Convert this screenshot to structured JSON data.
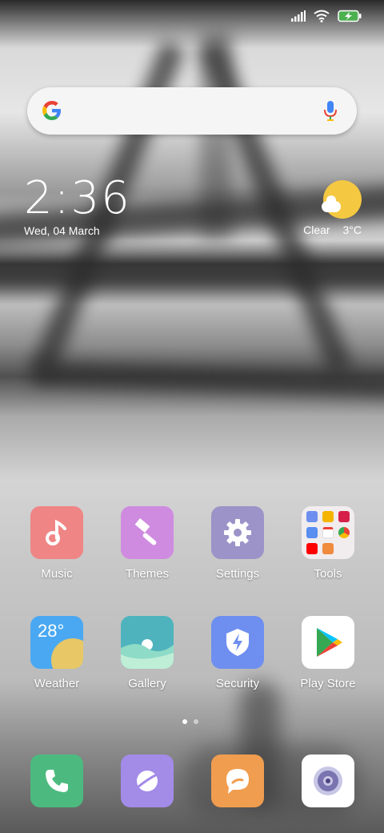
{
  "status_bar": {
    "icons": [
      "signal-icon",
      "wifi-icon",
      "battery-charging-icon"
    ]
  },
  "search_bar": {
    "logo": "google-g-icon",
    "mic": "microphone-icon"
  },
  "clock_widget": {
    "time": "2:36",
    "date": "Wed, 04 March"
  },
  "weather_widget": {
    "condition": "Clear",
    "temperature": "3°C"
  },
  "home_apps": [
    {
      "label": "Music",
      "icon": "music-note-icon",
      "color": "#ef8585"
    },
    {
      "label": "Themes",
      "icon": "paintbrush-icon",
      "color": "#cf8be0"
    },
    {
      "label": "Settings",
      "icon": "gear-icon",
      "color": "#9c93c8"
    },
    {
      "label": "Tools",
      "icon": "folder-icon",
      "color": "#f4f0f2"
    },
    {
      "label": "Weather",
      "icon": "weather-icon",
      "icon_text": "28°",
      "color": "#4aa8f2"
    },
    {
      "label": "Gallery",
      "icon": "gallery-icon",
      "color": "#6fcfc0"
    },
    {
      "label": "Security",
      "icon": "shield-icon",
      "color": "#6e8ff0"
    },
    {
      "label": "Play Store",
      "icon": "play-store-icon",
      "color": "#ffffff"
    }
  ],
  "page_indicator": {
    "pages": 2,
    "active": 0
  },
  "dock": [
    {
      "name": "phone",
      "icon": "phone-icon",
      "color": "#4cba7e"
    },
    {
      "name": "browser",
      "icon": "browser-icon",
      "color": "#a38be8"
    },
    {
      "name": "messaging",
      "icon": "chat-bubble-icon",
      "color": "#f09d4f"
    },
    {
      "name": "camera",
      "icon": "camera-icon",
      "color": "#ffffff"
    }
  ]
}
